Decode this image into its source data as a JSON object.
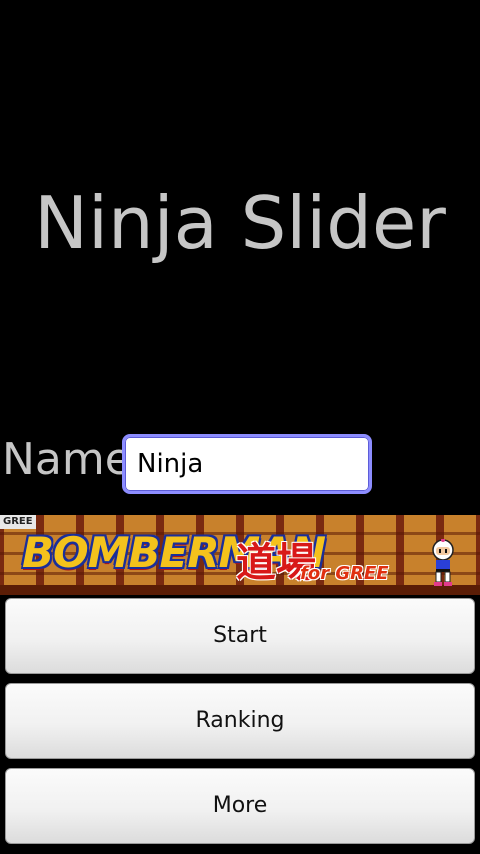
{
  "app": {
    "title": "Ninja Slider"
  },
  "name_field": {
    "label": "Name",
    "value": "Ninja"
  },
  "banner": {
    "brand_tag": "GREE",
    "game_logo": "BOMBERMAN",
    "game_subtitle": "道場",
    "game_subtitle_tag": "for GREE",
    "mascot_icon": "bomberman-mascot-icon"
  },
  "buttons": {
    "start_label": "Start",
    "ranking_label": "Ranking",
    "more_label": "More"
  },
  "colors": {
    "background": "#000000",
    "title_text": "#c6c6c6",
    "input_focus_border": "#8d8dff"
  }
}
